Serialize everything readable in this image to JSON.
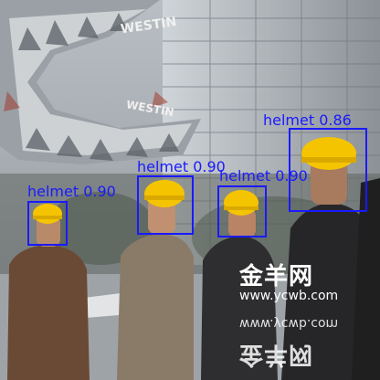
{
  "scene": {
    "building_sign_upper": "WESTIN",
    "building_sign_lower": "WESTIN"
  },
  "detections": [
    {
      "label": "helmet",
      "score": "0.90"
    },
    {
      "label": "helmet",
      "score": "0.90"
    },
    {
      "label": "helmet",
      "score": "0.90"
    },
    {
      "label": "helmet",
      "score": "0.86"
    }
  ],
  "watermark": {
    "url": "www.ycwb.com",
    "url_reflection": "www.ycwb.com",
    "logo_text": "金羊网",
    "logo_reflection": "金羊网"
  },
  "colors": {
    "box": "#1a1aff",
    "helmet": "#f5c400",
    "sky": "#c8cdd2"
  }
}
